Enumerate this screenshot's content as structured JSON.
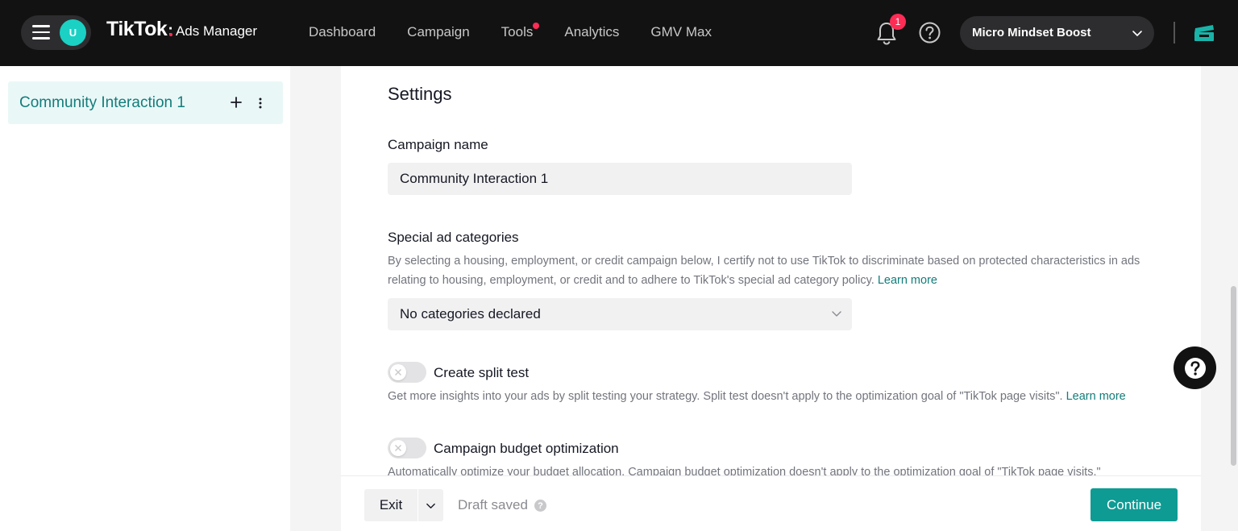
{
  "header": {
    "avatar_initial": "U",
    "brand_name": "TikTok",
    "brand_colon": ":",
    "brand_product": "Ads Manager",
    "nav": [
      {
        "label": "Dashboard"
      },
      {
        "label": "Campaign"
      },
      {
        "label": "Tools",
        "has_dot": true
      },
      {
        "label": "Analytics"
      },
      {
        "label": "GMV Max"
      }
    ],
    "notification_count": "1",
    "account_name": "Micro Mindset Boost",
    "icons": [
      "menu-icon",
      "bell-icon",
      "help-icon",
      "chevron-down-icon",
      "store-icon"
    ]
  },
  "sidebar": {
    "campaign_label": "Community Interaction 1"
  },
  "settings": {
    "title": "Settings",
    "campaign_name_label": "Campaign name",
    "campaign_name_value": "Community Interaction 1",
    "special_label": "Special ad categories",
    "special_desc": "By selecting a housing, employment, or credit campaign below, I certify not to use TikTok to discriminate based on protected characteristics in ads relating to housing, employment, or credit and to adhere to TikTok's special ad category policy.",
    "special_link": "Learn more",
    "special_select_value": "No categories declared",
    "split_label": "Create split test",
    "split_desc": "Get more insights into your ads by split testing your strategy. Split test doesn't apply to the optimization goal of \"TikTok page visits\".",
    "split_link": "Learn more",
    "cbo_label": "Campaign budget optimization",
    "cbo_desc": "Automatically optimize your budget allocation. Campaign budget optimization doesn't apply to the optimization goal of \"TikTok page visits.\""
  },
  "footer": {
    "exit_label": "Exit",
    "draft_status": "Draft saved",
    "draft_info_glyph": "?",
    "continue_label": "Continue"
  },
  "colors": {
    "accent": "#0e9b94",
    "link": "#127d7a",
    "badge": "#fe2c55",
    "topbar": "#121212"
  }
}
